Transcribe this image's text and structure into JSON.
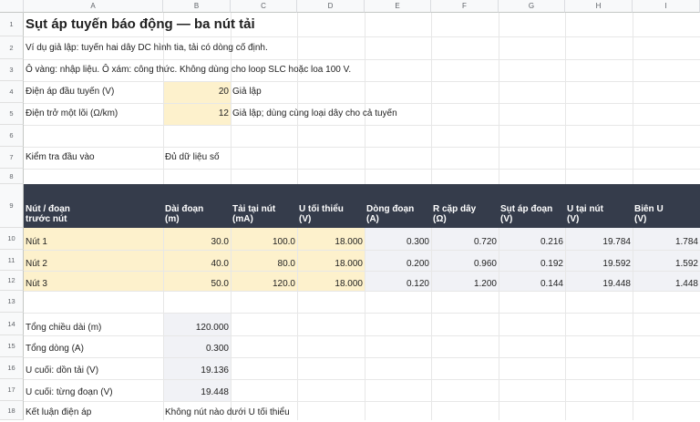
{
  "columns": [
    "A",
    "B",
    "C",
    "D",
    "E",
    "F",
    "G",
    "H",
    "I"
  ],
  "rows": [
    "1",
    "2",
    "3",
    "4",
    "5",
    "6",
    "7",
    "8",
    "9",
    "10",
    "11",
    "12",
    "13",
    "14",
    "15",
    "16",
    "17",
    "18"
  ],
  "title": "Sụt áp tuyến báo động — ba nút tải",
  "note1": "Ví dụ giả lập: tuyến hai dây DC hình tia, tải có dòng cố định.",
  "note2": "Ô vàng: nhập liệu. Ô xám: công thức. Không dùng cho loop SLC hoặc loa 100 V.",
  "inputs": [
    {
      "label": "Điện áp đầu tuyến (V)",
      "value": "20",
      "note": "Giả lập"
    },
    {
      "label": "Điện trở một lõi (Ω/km)",
      "value": "12",
      "note": "Giả lập; dùng cùng loại dây cho cả tuyến"
    }
  ],
  "check": {
    "label": "Kiểm tra đầu vào",
    "value": "Đủ dữ liệu số"
  },
  "table_headers": [
    {
      "line1": "Nút / đoạn",
      "line2": "trước nút"
    },
    {
      "line1": "Dài đoạn",
      "line2": "(m)"
    },
    {
      "line1": "Tải tại nút",
      "line2": "(mA)"
    },
    {
      "line1": "U tối thiểu",
      "line2": "(V)"
    },
    {
      "line1": "Dòng đoạn",
      "line2": "(A)"
    },
    {
      "line1": "R cặp dây",
      "line2": "(Ω)"
    },
    {
      "line1": "Sụt áp đoạn",
      "line2": "(V)"
    },
    {
      "line1": "U tại nút",
      "line2": "(V)"
    },
    {
      "line1": "Biên U",
      "line2": "(V)"
    }
  ],
  "table_rows": [
    [
      "Nút 1",
      "30.0",
      "100.0",
      "18.000",
      "0.300",
      "0.720",
      "0.216",
      "19.784",
      "1.784"
    ],
    [
      "Nút 2",
      "40.0",
      "80.0",
      "18.000",
      "0.200",
      "0.960",
      "0.192",
      "19.592",
      "1.592"
    ],
    [
      "Nút 3",
      "50.0",
      "120.0",
      "18.000",
      "0.120",
      "1.200",
      "0.144",
      "19.448",
      "1.448"
    ]
  ],
  "summary": [
    {
      "label": "Tổng chiều dài (m)",
      "value": "120.000"
    },
    {
      "label": "Tổng dòng (A)",
      "value": "0.300"
    },
    {
      "label": "U cuối: dồn tải (V)",
      "value": "19.136"
    },
    {
      "label": "U cuối: từng đoạn (V)",
      "value": "19.448"
    }
  ],
  "conclusion": {
    "label": "Kết luận điện áp",
    "value": "Không nút nào dưới U tối thiểu"
  },
  "colors": {
    "input": "#fdf1cc",
    "formula": "#f1f2f6",
    "header": "#353c4b"
  }
}
